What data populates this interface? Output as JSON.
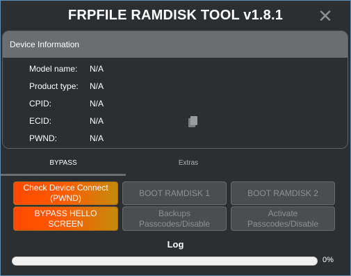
{
  "window": {
    "title": "FRPFILE RAMDISK TOOL v1.8.1",
    "close_glyph": "✕"
  },
  "device_info": {
    "header": "Device Information",
    "rows": [
      {
        "label": "Model name:",
        "value": "N/A"
      },
      {
        "label": "Product type:",
        "value": "N/A"
      },
      {
        "label": "CPID:",
        "value": "N/A"
      },
      {
        "label": "ECID:",
        "value": "N/A"
      },
      {
        "label": "PWND:",
        "value": "N/A"
      }
    ],
    "copy_icon": "copy-icon"
  },
  "tabs": [
    {
      "label": "BYPASS",
      "active": true
    },
    {
      "label": "Extras",
      "active": false
    }
  ],
  "buttons": {
    "check_device": {
      "line1": "Check Device Connect",
      "line2": "(PWND)",
      "enabled": true
    },
    "bypass_hello": {
      "line1": "BYPASS HELLO",
      "line2": "SCREEN",
      "enabled": true
    },
    "boot_ramdisk_1": {
      "label": "BOOT RAMDISK 1",
      "enabled": false
    },
    "boot_ramdisk_2": {
      "label": "BOOT RAMDISK 2",
      "enabled": false
    },
    "backups": {
      "line1": "Backups",
      "line2": "Passcodes/Disable",
      "enabled": false
    },
    "activate": {
      "line1": "Activate",
      "line2": "Passcodes/Disable",
      "enabled": false
    }
  },
  "log": {
    "label": "Log",
    "progress_value": 0,
    "progress_text": "0%"
  },
  "colors": {
    "accent_start": "#ff4a00",
    "accent_end": "#c58a0c",
    "panel_header": "#6b6e71"
  }
}
